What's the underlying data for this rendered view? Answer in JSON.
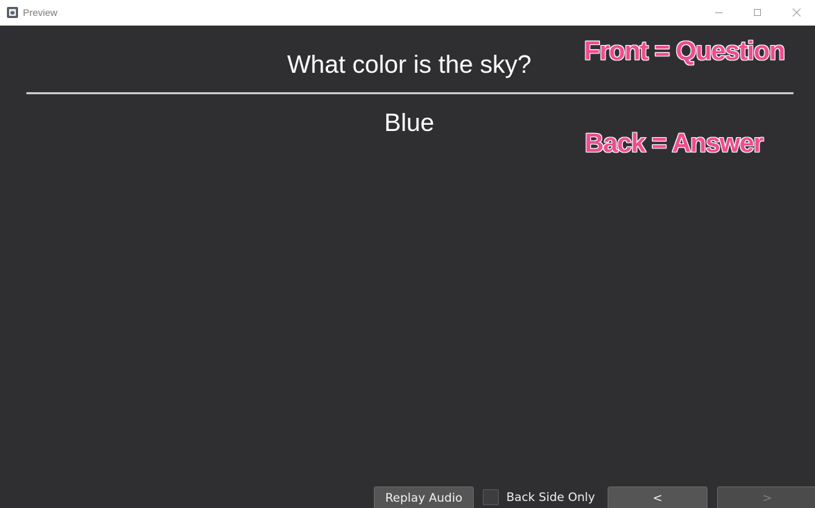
{
  "window": {
    "title": "Preview",
    "icon": "app-icon"
  },
  "card": {
    "question": "What color is the sky?",
    "answer": "Blue"
  },
  "annotations": {
    "front": "Front = Question",
    "back": "Back = Answer",
    "color": "#ef4c8f"
  },
  "controls": {
    "replay_label": "Replay Audio",
    "back_side_only_label": "Back Side Only",
    "back_side_only_checked": false,
    "prev_label": "<",
    "next_label": ">"
  },
  "colors": {
    "background": "#2f2f31",
    "text": "#ffffff",
    "button": "#555555"
  }
}
